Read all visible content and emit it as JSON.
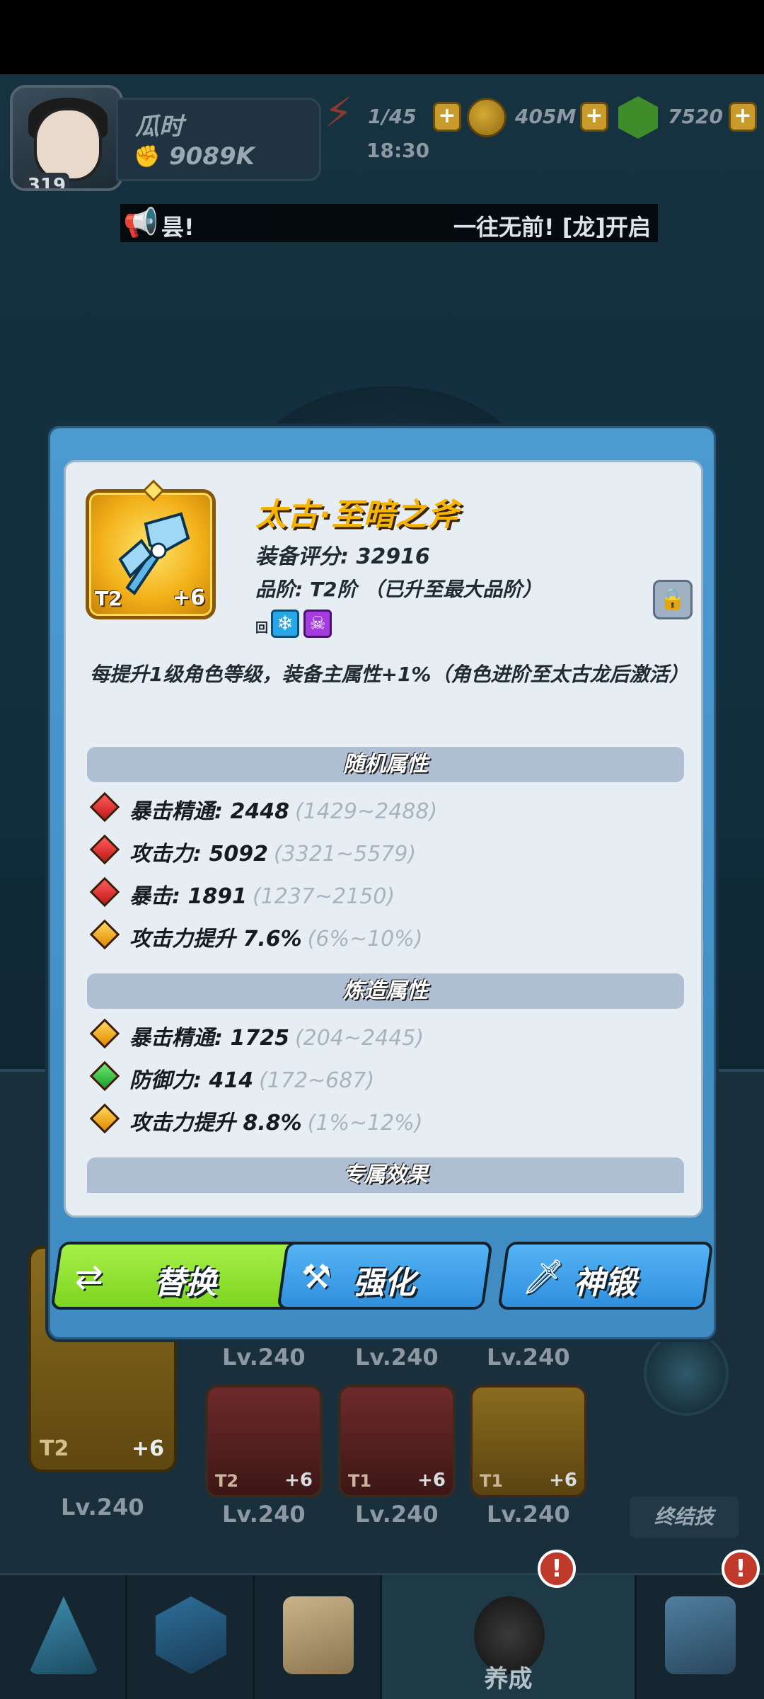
{
  "hud": {
    "player_level": "319",
    "player_name": "瓜时",
    "player_power": "9089K",
    "energy": "1/45",
    "energy_timer": "18:30",
    "gold": "405M",
    "gems": "7520",
    "plus_label": "+"
  },
  "announcement": {
    "left_text": "昙!",
    "right_text": "一往无前! [龙]开启"
  },
  "item": {
    "name": "太古·至暗之斧",
    "score": "装备评分: 32916",
    "grade": "品阶: T2阶 （已升至最大品阶）",
    "tier": "T2",
    "plus": "+6",
    "mini_tag": "回",
    "description": "每提升1级角色等级，装备主属性+1%（角色进阶至太古龙后激活）"
  },
  "sections": {
    "random": "随机属性",
    "forge": "炼造属性",
    "exclusive": "专属效果"
  },
  "random_attrs": [
    {
      "label": "暴击精通: 2448",
      "range": "(1429~2488)",
      "gem": "red"
    },
    {
      "label": "攻击力: 5092",
      "range": "(3321~5579)",
      "gem": "red"
    },
    {
      "label": "暴击: 1891",
      "range": "(1237~2150)",
      "gem": "red"
    },
    {
      "label": "攻击力提升 7.6%",
      "range": "(6%~10%)",
      "gem": "gold"
    }
  ],
  "forge_attrs": [
    {
      "label": "暴击精通: 1725",
      "range": "(204~2445)",
      "gem": "gold"
    },
    {
      "label": "防御力: 414",
      "range": "(172~687)",
      "gem": "green"
    },
    {
      "label": "攻击力提升 8.8%",
      "range": "(1%~12%)",
      "gem": "gold"
    }
  ],
  "buttons": {
    "replace": "替换",
    "enhance": "强化",
    "forge": "神锻"
  },
  "background": {
    "slots_top_levels": [
      "Lv.240",
      "Lv.240",
      "Lv.240"
    ],
    "big_slot": {
      "tier": "T2",
      "plus": "+6",
      "level": "Lv.240"
    },
    "slots": [
      {
        "tier": "T2",
        "plus": "+6",
        "level": "Lv.240"
      },
      {
        "tier": "T1",
        "plus": "+6",
        "level": "Lv.240"
      },
      {
        "tier": "T1",
        "plus": "+6",
        "level": "Lv.240"
      }
    ],
    "ultimate_label": "终结技"
  },
  "nav": {
    "active_label": "养成",
    "alert": "!"
  },
  "colors": {
    "modal_border": "#4b9ad1",
    "item_name": "#f5b400",
    "replace_button": "#a6f04a",
    "action_button": "#55b4f5"
  }
}
